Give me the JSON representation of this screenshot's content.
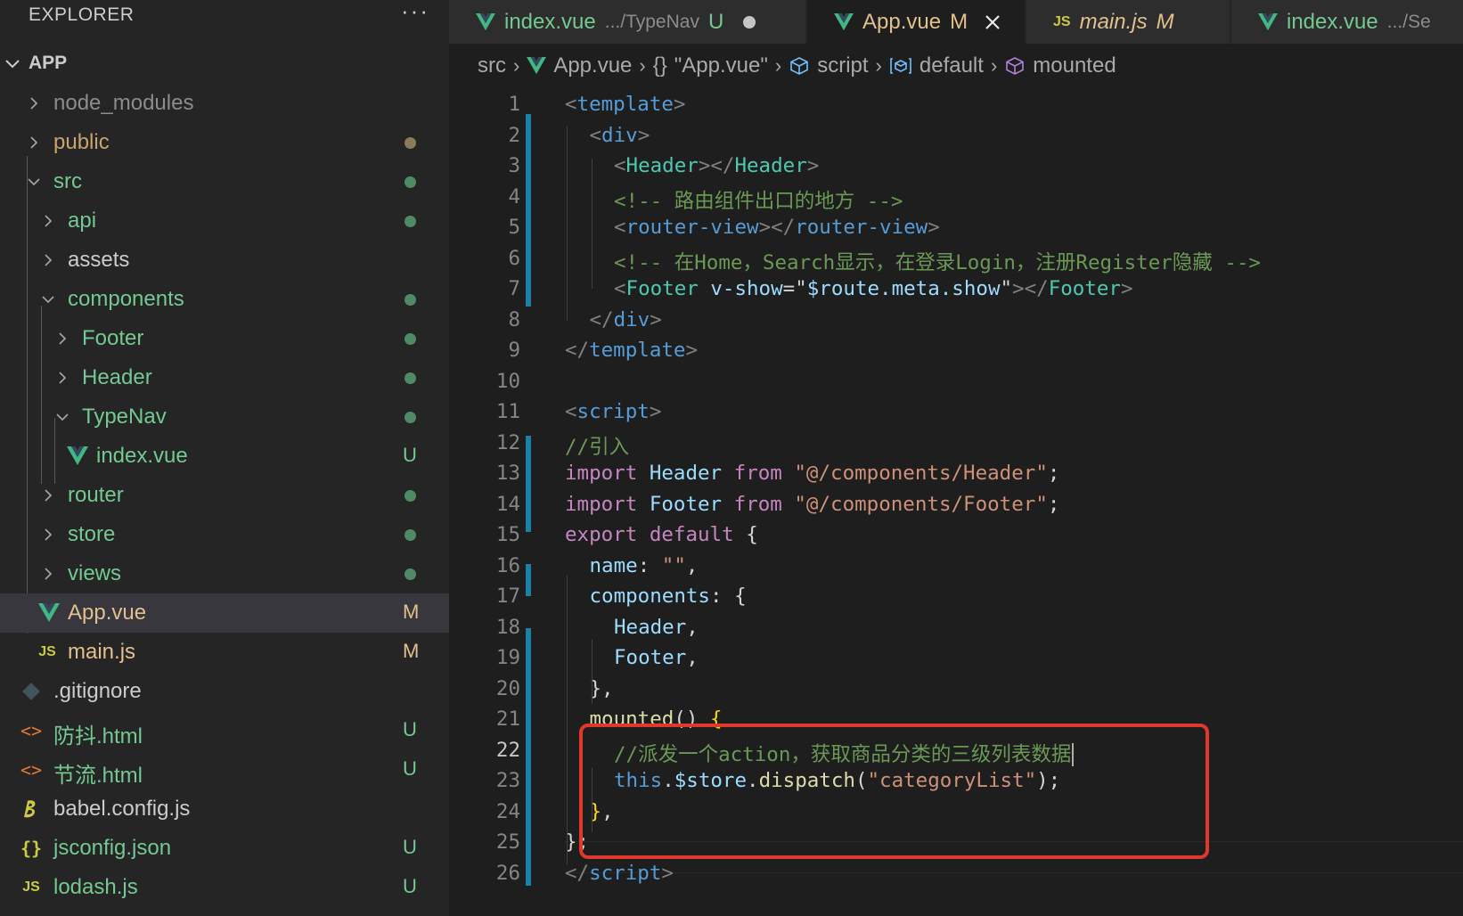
{
  "sidebar": {
    "title": "EXPLORER",
    "more": "···",
    "root": "APP",
    "items": [
      {
        "label": "node_modules",
        "badge": ""
      },
      {
        "label": "public",
        "badge": ""
      },
      {
        "label": "src",
        "badge": ""
      },
      {
        "label": "api",
        "badge": ""
      },
      {
        "label": "assets",
        "badge": ""
      },
      {
        "label": "components",
        "badge": ""
      },
      {
        "label": "Footer",
        "badge": ""
      },
      {
        "label": "Header",
        "badge": ""
      },
      {
        "label": "TypeNav",
        "badge": ""
      },
      {
        "label": "index.vue",
        "badge": "U"
      },
      {
        "label": "router",
        "badge": ""
      },
      {
        "label": "store",
        "badge": ""
      },
      {
        "label": "views",
        "badge": ""
      },
      {
        "label": "App.vue",
        "badge": "M"
      },
      {
        "label": "main.js",
        "badge": "M"
      },
      {
        "label": ".gitignore",
        "badge": ""
      },
      {
        "label": "防抖.html",
        "badge": "U"
      },
      {
        "label": "节流.html",
        "badge": "U"
      },
      {
        "label": "babel.config.js",
        "badge": ""
      },
      {
        "label": "jsconfig.json",
        "badge": "U"
      },
      {
        "label": "lodash.js",
        "badge": "U"
      }
    ]
  },
  "tabs": [
    {
      "name": "index.vue",
      "desc": ".../TypeNav",
      "badge": "U"
    },
    {
      "name": "App.vue",
      "desc": "",
      "badge": "M"
    },
    {
      "name": "main.js",
      "desc": "",
      "badge": "M"
    },
    {
      "name": "index.vue",
      "desc": ".../Se",
      "badge": ""
    }
  ],
  "breadcrumb": [
    "src",
    "App.vue",
    "\"App.vue\"",
    "script",
    "default",
    "mounted"
  ],
  "icons": {
    "js": "JS",
    "json": "{}",
    "html": "<>",
    "obj": "{}"
  },
  "editor": {
    "lines": [
      {
        "n": "1",
        "t": [
          "<",
          "template",
          ">"
        ]
      },
      {
        "n": "2",
        "t": [
          "<",
          "div",
          ">"
        ]
      },
      {
        "n": "3",
        "t": [
          "<",
          "Header",
          "></",
          "Header",
          ">"
        ]
      },
      {
        "n": "4",
        "t": [
          "<!-- 路由组件出口的地方 -->"
        ]
      },
      {
        "n": "5",
        "t": [
          "<",
          "router-view",
          "></",
          "router-view",
          ">"
        ]
      },
      {
        "n": "6",
        "t": [
          "<!-- 在Home，Search显示，在登录Login，注册Register隐藏 -->"
        ]
      },
      {
        "n": "7",
        "t": [
          "<",
          "Footer",
          " ",
          "v-show",
          "=",
          "\"",
          "$route.meta.show",
          "\"",
          "></",
          "Footer",
          ">"
        ]
      },
      {
        "n": "8",
        "t": [
          "</",
          "div",
          ">"
        ]
      },
      {
        "n": "9",
        "t": [
          "</",
          "template",
          ">"
        ]
      },
      {
        "n": "10",
        "t": []
      },
      {
        "n": "11",
        "t": [
          "<",
          "script",
          ">"
        ]
      },
      {
        "n": "12",
        "t": [
          "//引入"
        ]
      },
      {
        "n": "13",
        "t": [
          "import",
          " ",
          "Header",
          " ",
          "from",
          " ",
          "\"@/components/Header\"",
          ";"
        ]
      },
      {
        "n": "14",
        "t": [
          "import",
          " ",
          "Footer",
          " ",
          "from",
          " ",
          "\"@/components/Footer\"",
          ";"
        ]
      },
      {
        "n": "15",
        "t": [
          "export",
          " ",
          "default",
          " ",
          "{"
        ]
      },
      {
        "n": "16",
        "t": [
          "name",
          ": ",
          "\"\"",
          ","
        ]
      },
      {
        "n": "17",
        "t": [
          "components",
          ": ",
          "{"
        ]
      },
      {
        "n": "18",
        "t": [
          "Header",
          ","
        ]
      },
      {
        "n": "19",
        "t": [
          "Footer",
          ","
        ]
      },
      {
        "n": "20",
        "t": [
          "}",
          ","
        ]
      },
      {
        "n": "21",
        "t": [
          "mounted",
          "() ",
          "{"
        ]
      },
      {
        "n": "22",
        "t": [
          "//派发一个action，获取商品分类的三级列表数据"
        ]
      },
      {
        "n": "23",
        "t": [
          "this",
          ".",
          "$store",
          ".",
          "dispatch",
          "(",
          "\"categoryList\"",
          ");"
        ]
      },
      {
        "n": "24",
        "t": [
          "}",
          ","
        ]
      },
      {
        "n": "25",
        "t": [
          "};"
        ]
      },
      {
        "n": "26",
        "t": [
          "</",
          "script",
          ">"
        ]
      }
    ]
  },
  "colors": {
    "accent_blue": "#1b81a8",
    "highlight_red": "#e0382b",
    "modified": "#e2c08d",
    "untracked": "#73c991",
    "vue_green": "#41b883"
  }
}
